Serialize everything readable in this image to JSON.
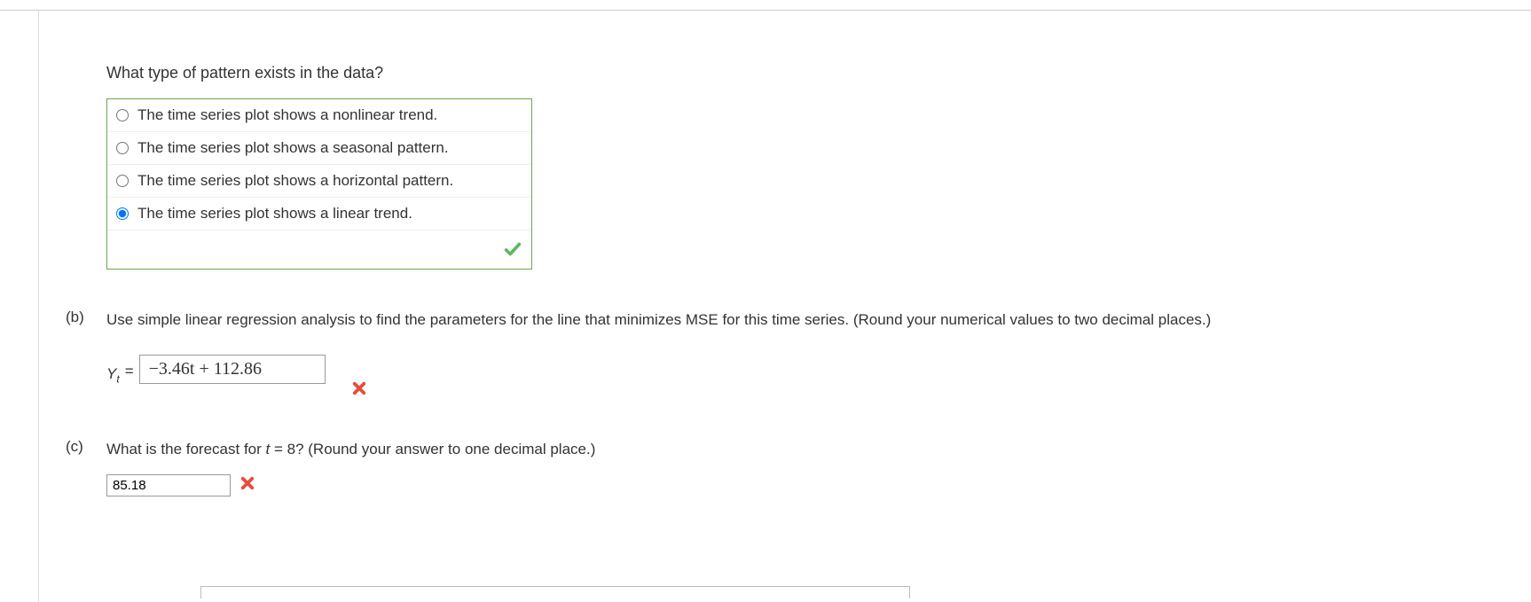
{
  "question_a": {
    "prompt": "What type of pattern exists in the data?",
    "options": [
      "The time series plot shows a nonlinear trend.",
      "The time series plot shows a seasonal pattern.",
      "The time series plot shows a horizontal pattern.",
      "The time series plot shows a linear trend."
    ],
    "selected_index": 3,
    "correct": true
  },
  "question_b": {
    "label": "(b)",
    "prompt": "Use simple linear regression analysis to find the parameters for the line that minimizes MSE for this time series. (Round your numerical values to two decimal places.)",
    "y_label": "Y",
    "y_sub": "t",
    "equals": "=",
    "answer": "−3.46t + 112.86",
    "correct": false
  },
  "question_c": {
    "label": "(c)",
    "prompt_prefix": "What is the forecast for ",
    "t_var": "t",
    "prompt_suffix": " = 8? (Round your answer to one decimal place.)",
    "answer": "85.18",
    "correct": false
  }
}
